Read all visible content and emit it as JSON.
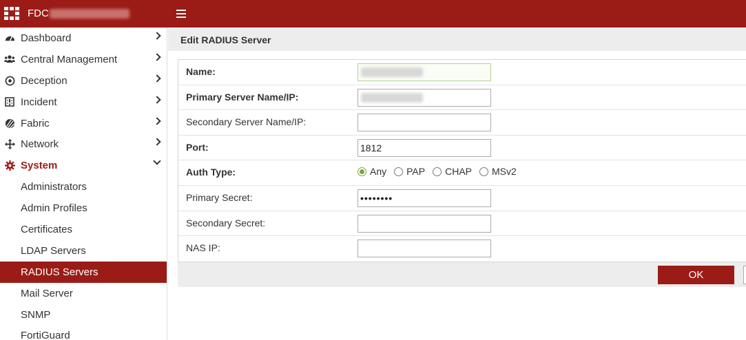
{
  "topbar": {
    "brand": "FDC"
  },
  "sidebar": {
    "items": [
      {
        "label": "Dashboard",
        "icon": "dashboard-icon"
      },
      {
        "label": "Central Management",
        "icon": "users-icon"
      },
      {
        "label": "Deception",
        "icon": "deception-icon"
      },
      {
        "label": "Incident",
        "icon": "incident-icon"
      },
      {
        "label": "Fabric",
        "icon": "fabric-icon"
      },
      {
        "label": "Network",
        "icon": "network-icon"
      },
      {
        "label": "System",
        "icon": "gear-icon",
        "expanded": true
      }
    ],
    "subitems": [
      {
        "label": "Administrators"
      },
      {
        "label": "Admin Profiles"
      },
      {
        "label": "Certificates"
      },
      {
        "label": "LDAP Servers"
      },
      {
        "label": "RADIUS Servers",
        "active": true
      },
      {
        "label": "Mail Server"
      },
      {
        "label": "SNMP"
      },
      {
        "label": "FortiGuard"
      }
    ]
  },
  "main": {
    "title": "Edit RADIUS Server",
    "fields": {
      "name": {
        "label": "Name:"
      },
      "primary_server": {
        "label": "Primary Server Name/IP:"
      },
      "secondary_server": {
        "label": "Secondary Server Name/IP:",
        "value": ""
      },
      "port": {
        "label": "Port:",
        "value": "1812"
      },
      "auth_type": {
        "label": "Auth Type:",
        "options": [
          "Any",
          "PAP",
          "CHAP",
          "MSv2"
        ],
        "selected": "Any"
      },
      "primary_secret": {
        "label": "Primary Secret:",
        "value": "••••••••"
      },
      "secondary_secret": {
        "label": "Secondary Secret:",
        "value": ""
      },
      "nas_ip": {
        "label": "NAS IP:",
        "value": ""
      }
    },
    "ok_label": "OK"
  },
  "colors": {
    "brand": "#9b1c17",
    "radio_selected": "#7aa53c"
  }
}
